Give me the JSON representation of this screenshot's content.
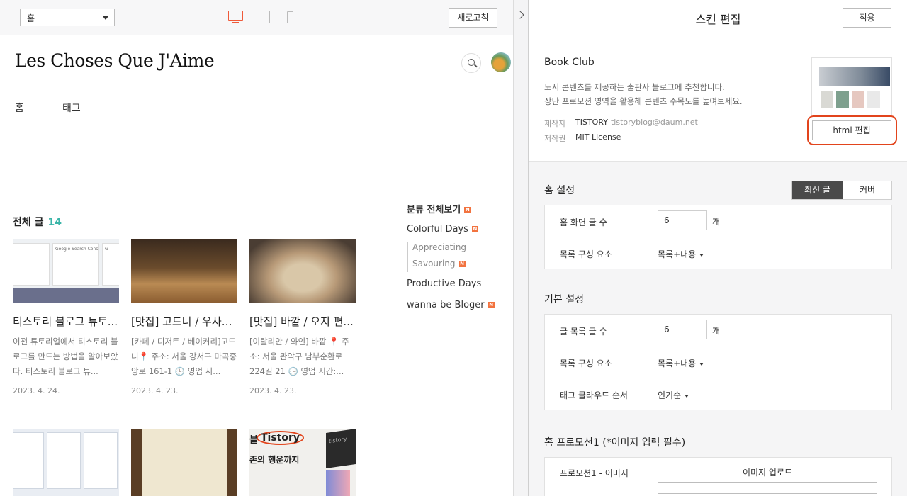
{
  "toolbar": {
    "page_select": "홈",
    "refresh_label": "새로고침"
  },
  "blog": {
    "title": "Les Choses Que J'Aime",
    "nav": [
      "홈",
      "태그"
    ],
    "all_posts_label": "전체 글",
    "all_posts_count": "14",
    "posts": [
      {
        "title": "티스토리 블로그 튜토...",
        "excerpt": "이전 튜토리얼에서 티스토리 블로그를 만드는 방법을 알아보았다. 티스토리 블로그 튜...",
        "date": "2023. 4. 24."
      },
      {
        "title": "[맛집] 고드니 / 우사기...",
        "excerpt": "[카페 / 디저트 / 베이커리]고드니📍 주소: 서울 강서구 마곡중앙로 161-1 🕒 영업 시...",
        "date": "2023. 4. 23."
      },
      {
        "title": "[맛집] 바깥 / 오지 편...",
        "excerpt": "[이탈리안 / 와인] 바깥 📍 주소: 서울 관악구 남부순환로 224길 21 🕒 영업 시간:...",
        "date": "2023. 4. 23."
      }
    ],
    "thumb_texts": {
      "t1_card1": "Google Search Console",
      "t1_card2": "G",
      "t6_brand": "Tistory",
      "t6_line1": "블",
      "t6_line2": "존의 행운까지",
      "t6_box": "tistory"
    },
    "sidebar": {
      "all_categories": "분류 전체보기",
      "items": [
        "Colorful Days",
        "Appreciating",
        "Savouring",
        "Productive Days",
        "wanna be Bloger"
      ],
      "new_badge": "N"
    }
  },
  "panel": {
    "title": "스킨 편집",
    "apply_label": "적용",
    "skin": {
      "name": "Book Club",
      "desc_line1": "도서 콘텐츠를 제공하는 출판사 블로그에 추천합니다.",
      "desc_line2": "상단 프로모션 영역을 활용해 콘텐츠 주목도를 높여보세요.",
      "maker_label": "제작자",
      "maker": "TISTORY",
      "maker_email": "tistoryblog@daum.net",
      "license_label": "저작권",
      "license": "MIT License",
      "html_edit_label": "html 편집"
    },
    "home_settings": {
      "title": "홈 설정",
      "seg_on": "최신 글",
      "seg_off": "커버",
      "count_label": "홈 화면 글 수",
      "count_value": "6",
      "unit": "개",
      "list_label": "목록 구성 요소",
      "list_value": "목록+내용"
    },
    "basic_settings": {
      "title": "기본 설정",
      "count_label": "글 목록 글 수",
      "count_value": "6",
      "unit": "개",
      "list_label": "목록 구성 요소",
      "list_value": "목록+내용",
      "tag_label": "태그 클라우드 순서",
      "tag_value": "인기순"
    },
    "promo": {
      "title": "홈 프로모션1 (*이미지 입력 필수)",
      "image_label": "프로모션1 - 이미지",
      "upload_label": "이미지 업로드"
    }
  },
  "colors": {
    "accent": "#ef5a3a",
    "count": "#3ab5a8",
    "highlight": "#e2441c",
    "seg_active": "#4a4a4a"
  }
}
